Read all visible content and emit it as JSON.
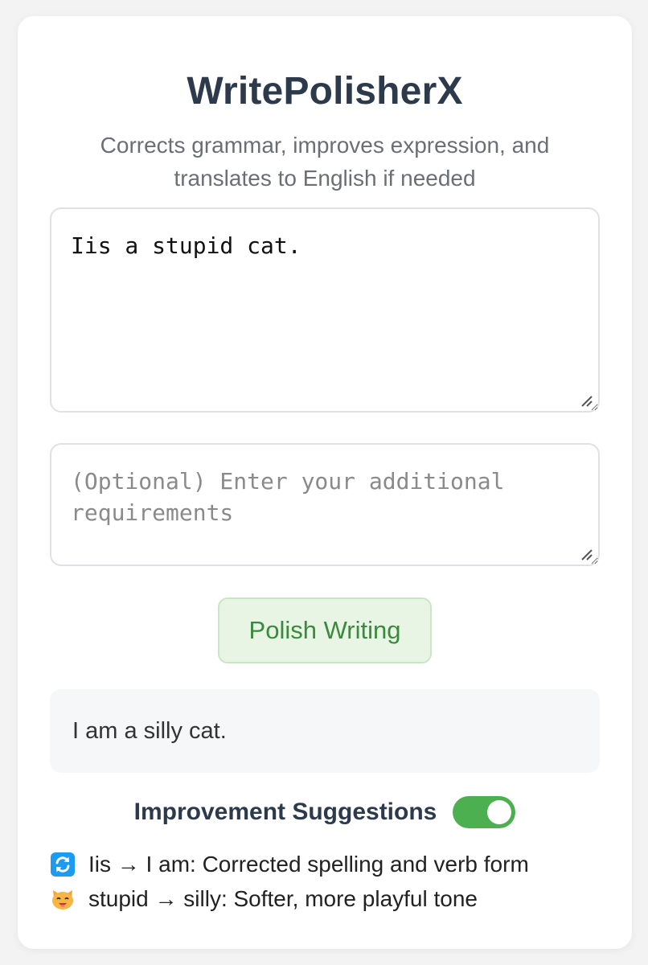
{
  "app": {
    "title": "WritePolisherX",
    "subtitle": "Corrects grammar, improves expression, and translates to English if needed"
  },
  "input": {
    "value": "Iis a stupid cat."
  },
  "requirements": {
    "value": "",
    "placeholder": "(Optional) Enter your additional requirements"
  },
  "action": {
    "polish_label": "Polish Writing"
  },
  "result": {
    "text": "I am a silly cat."
  },
  "suggestions": {
    "title": "Improvement Suggestions",
    "toggle_on": true,
    "items": [
      {
        "icon": "refresh-arrows-icon",
        "text": "Iis → I am: Corrected spelling and verb form"
      },
      {
        "icon": "cat-face-icon",
        "text": "stupid → silly: Softer, more playful tone"
      }
    ]
  },
  "colors": {
    "accent_green": "#4caf50",
    "button_bg": "#e8f5e5",
    "button_text": "#3a8a3e",
    "title": "#2c3a4b"
  }
}
